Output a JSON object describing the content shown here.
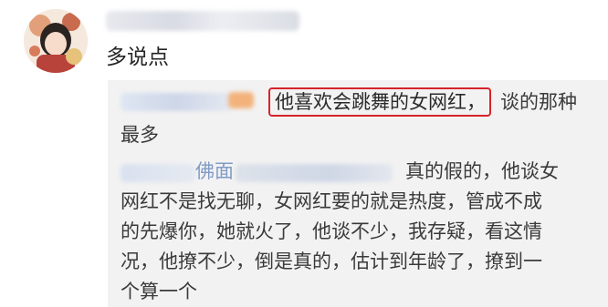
{
  "comment": {
    "text": "多说点"
  },
  "reply_quote": {
    "line1_highlight": "他喜欢会跳舞的女网红，",
    "line1_rest": "谈的那种",
    "line2": "最多",
    "mention_fragment": "佛面",
    "line3_tail": "真的假的，他谈女",
    "line4": "网红不是找无聊，女网红要的就是热度，管成不成",
    "line5": "的先爆你，她就火了，他谈不少，我存疑，看这情",
    "line6": "况，他撩不少，倒是真的，估计到年龄了，撩到一",
    "line7": "个算一个"
  },
  "colors": {
    "highlight_border": "#d8232a",
    "quote_background": "#f2f2f2",
    "text": "#262626"
  }
}
